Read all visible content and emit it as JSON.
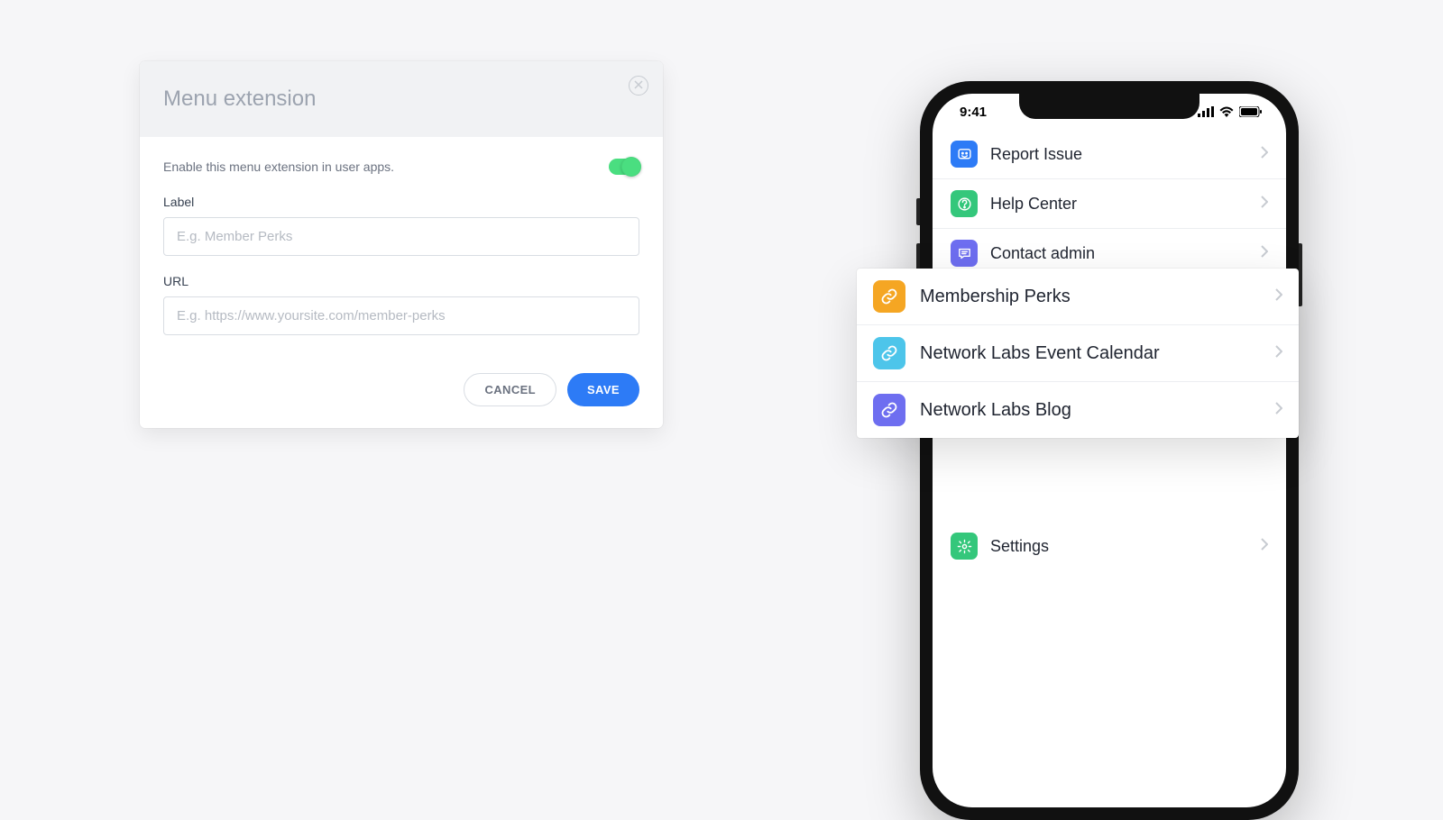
{
  "modal": {
    "title": "Menu extension",
    "enable_text": "Enable this menu extension in user apps.",
    "toggle_on": true,
    "fields": {
      "label": {
        "caption": "Label",
        "placeholder": "E.g. Member Perks",
        "value": ""
      },
      "url": {
        "caption": "URL",
        "placeholder": "E.g. https://www.yoursite.com/member-perks",
        "value": ""
      }
    },
    "buttons": {
      "cancel": "CANCEL",
      "save": "SAVE"
    }
  },
  "phone": {
    "status": {
      "time": "9:41"
    },
    "menu": [
      {
        "label": "Report Issue",
        "icon": "report",
        "color": "#2d7bf6"
      },
      {
        "label": "Help Center",
        "icon": "help",
        "color": "#34c77b"
      },
      {
        "label": "Contact admin",
        "icon": "contact",
        "color": "#6e6ef0"
      }
    ],
    "settings": {
      "label": "Settings",
      "icon": "settings",
      "color": "#34c77b"
    }
  },
  "extensions": [
    {
      "label": "Membership Perks",
      "color": "#f5a623"
    },
    {
      "label": "Network Labs Event Calendar",
      "color": "#4dc5ea"
    },
    {
      "label": "Network Labs Blog",
      "color": "#6e6ef0"
    }
  ]
}
